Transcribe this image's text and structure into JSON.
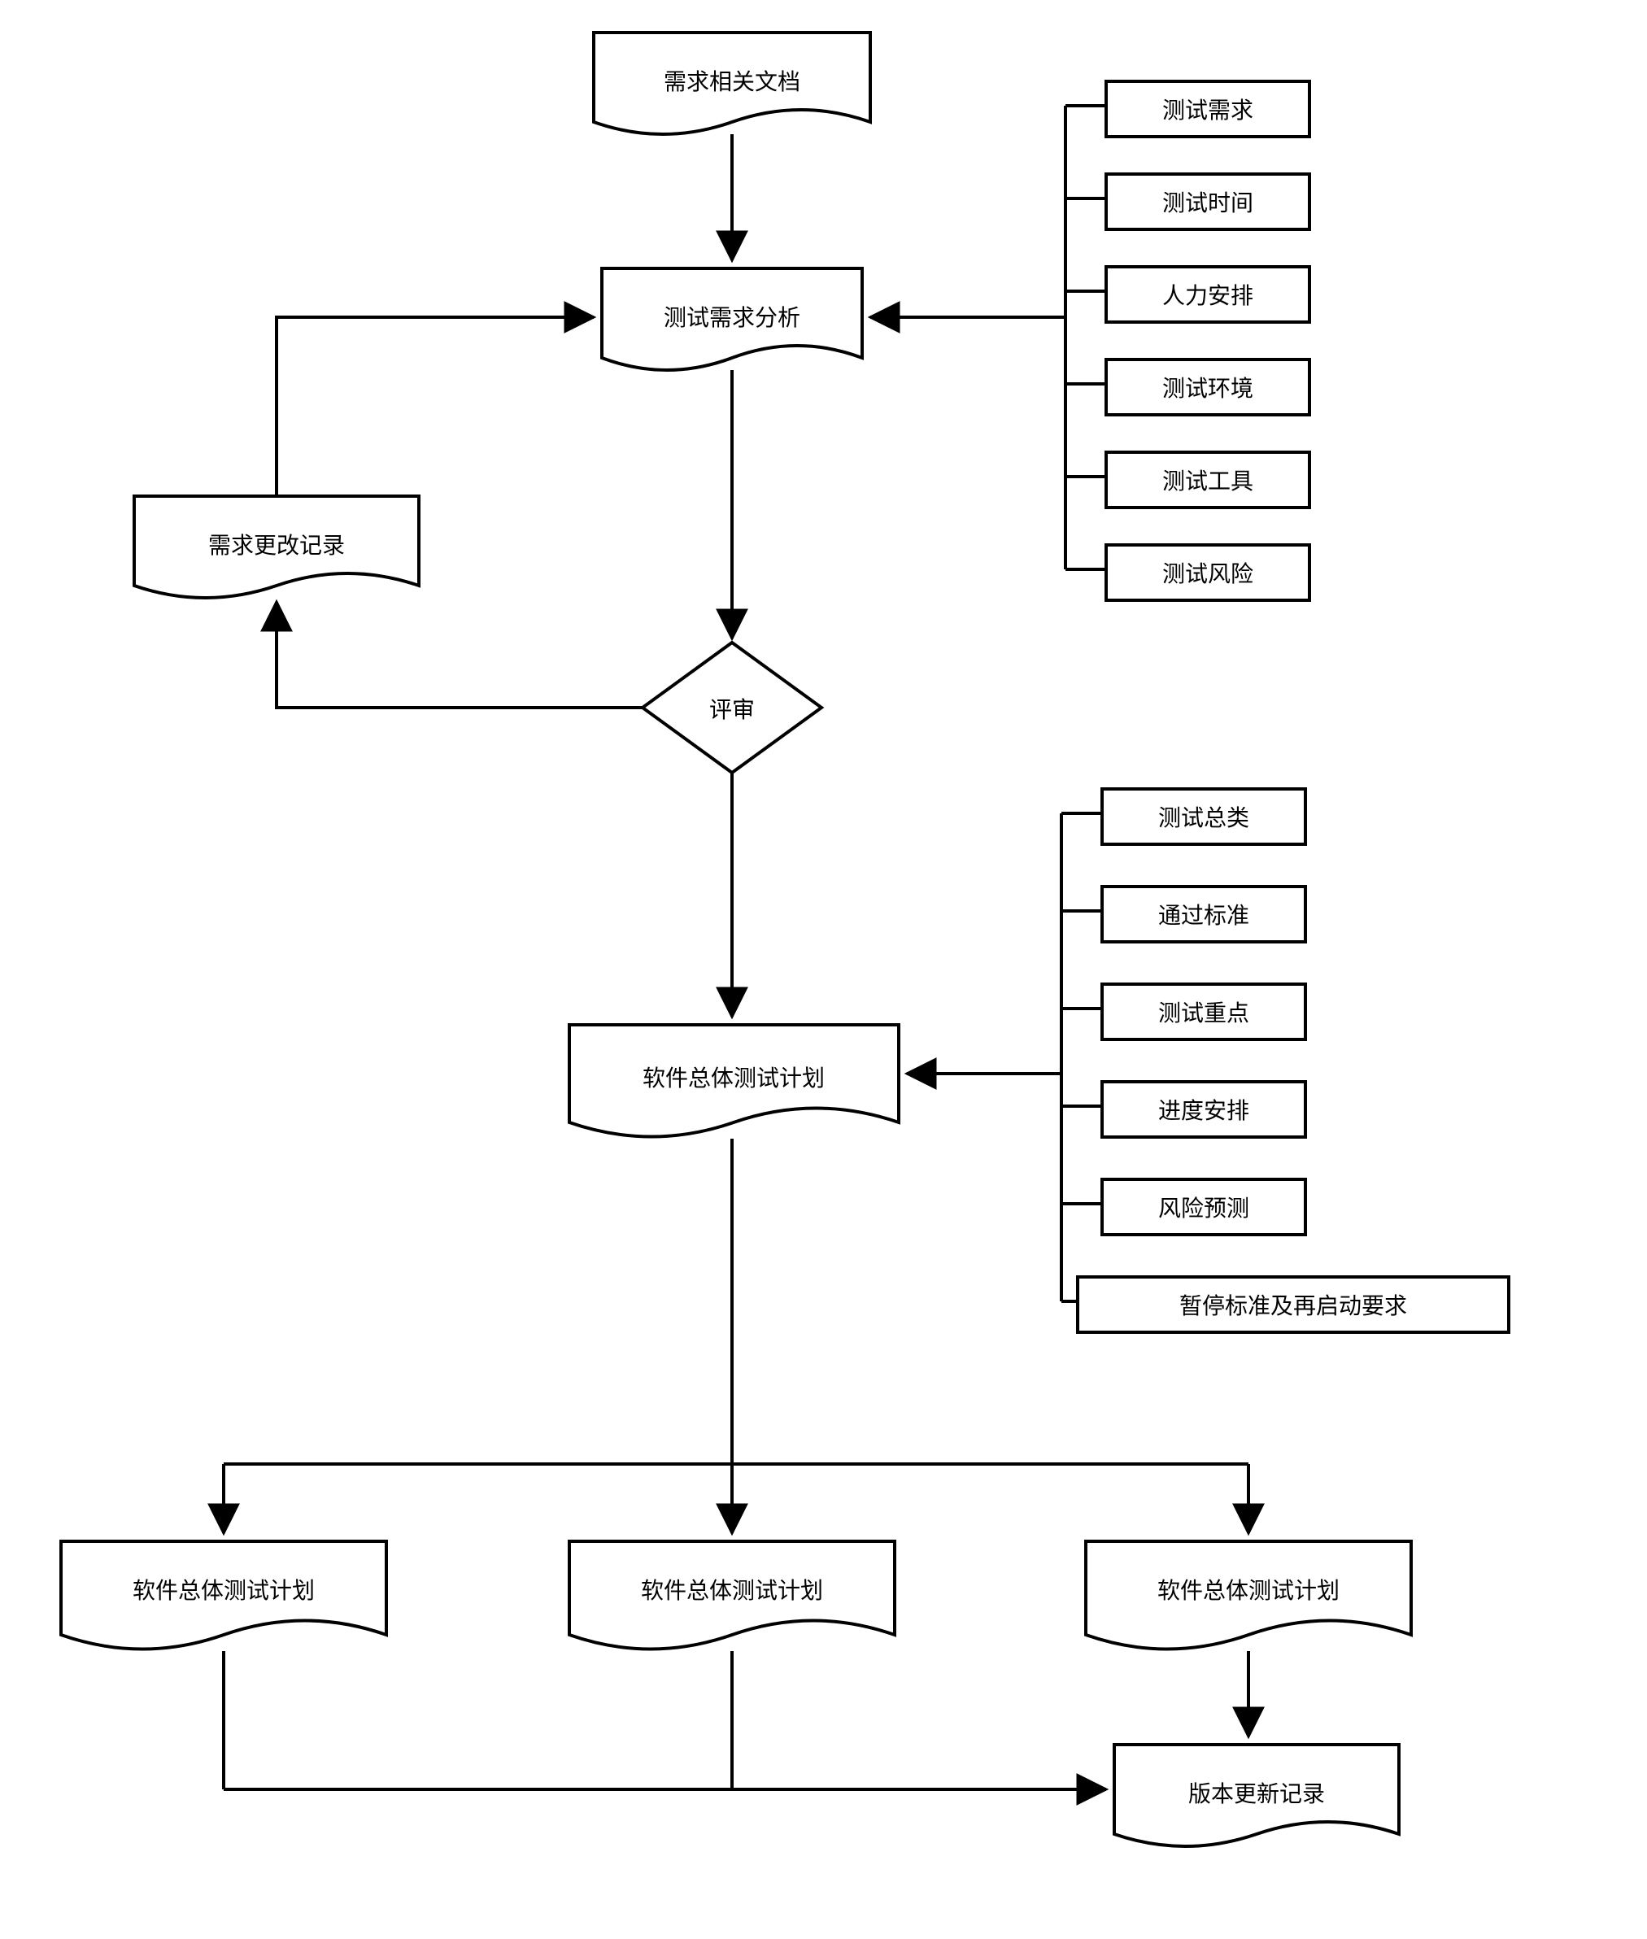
{
  "doc_input": "需求相关文档",
  "analysis": "测试需求分析",
  "review": "评审",
  "change_log": "需求更改记录",
  "plan": "软件总体测试计划",
  "child_plan_1": "软件总体测试计划",
  "child_plan_2": "软件总体测试计划",
  "child_plan_3": "软件总体测试计划",
  "version_log": "版本更新记录",
  "analysis_factors": [
    "测试需求",
    "测试时间",
    "人力安排",
    "测试环境",
    "测试工具",
    "测试风险"
  ],
  "plan_factors": [
    "测试总类",
    "通过标准",
    "测试重点",
    "进度安排",
    "风险预测",
    "暂停标准及再启动要求"
  ]
}
